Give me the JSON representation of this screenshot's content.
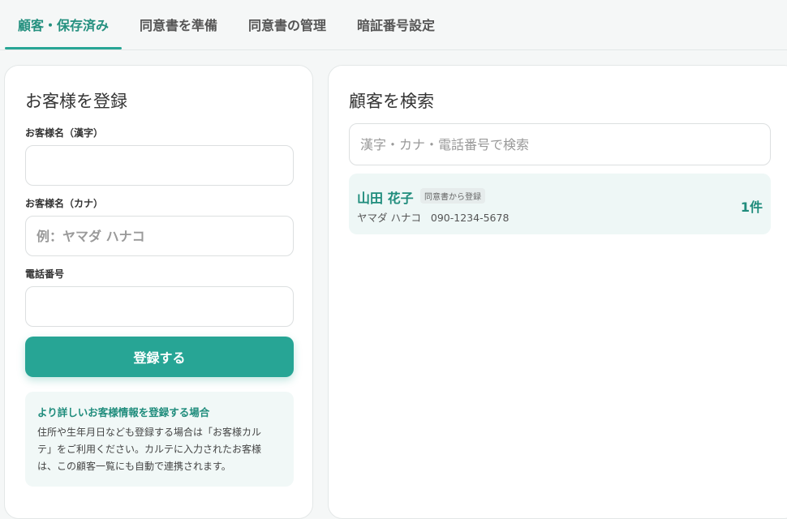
{
  "tabs": [
    {
      "label": "顧客・保存済み",
      "active": true
    },
    {
      "label": "同意書を準備",
      "active": false
    },
    {
      "label": "同意書の管理",
      "active": false
    },
    {
      "label": "暗証番号設定",
      "active": false
    }
  ],
  "register": {
    "title": "お客様を登録",
    "kanji_label": "お客様名（漢字）",
    "kanji_value": "",
    "kana_label": "お客様名（カナ）",
    "kana_placeholder": "例：ヤマダ ハナコ",
    "kana_value": "",
    "phone_label": "電話番号",
    "phone_value": "",
    "submit_label": "登録する",
    "info_title": "より詳しいお客様情報を登録する場合",
    "info_line1": "住所や生年月日なども登録する場合は「お客様カル",
    "info_line2": "テ」をご利用ください。カルテに入力されたお客様",
    "info_line3": "は、この顧客一覧にも自動で連携されます。"
  },
  "search": {
    "title": "顧客を検索",
    "placeholder": "漢字・カナ・電話番号で検索",
    "value": "",
    "results": [
      {
        "name": "山田 花子",
        "badge": "同意書から登録",
        "kana": "ヤマダ ハナコ",
        "phone": "090-1234-5678",
        "count": "1件"
      }
    ]
  },
  "colors": {
    "accent": "#27a595",
    "accent_text": "#1f8c7c",
    "result_bg": "#eef7f6",
    "info_bg": "#f1f8f7"
  }
}
